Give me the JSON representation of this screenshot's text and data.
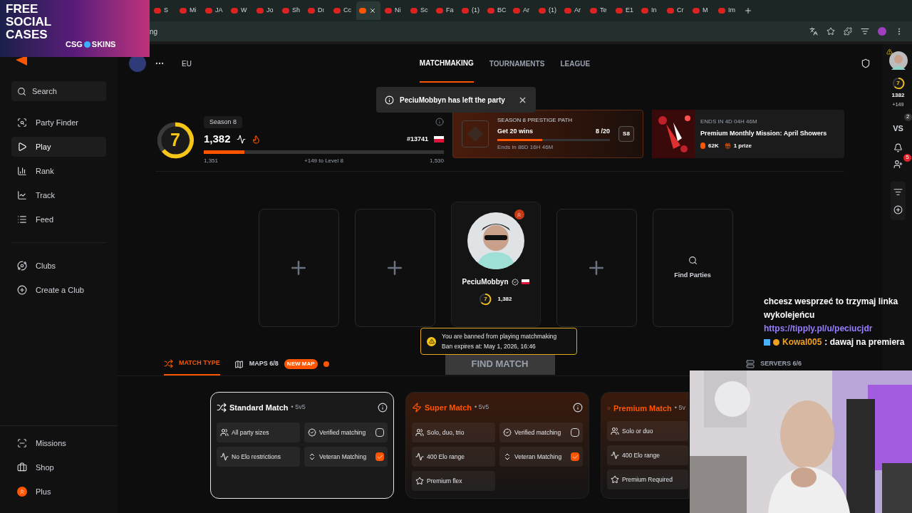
{
  "browser": {
    "tabs": [
      {
        "label": "S",
        "selected": false
      },
      {
        "label": "Mi",
        "selected": false
      },
      {
        "label": "JA",
        "selected": false
      },
      {
        "label": "W",
        "selected": false
      },
      {
        "label": "Jo",
        "selected": false
      },
      {
        "label": "Sh",
        "selected": false
      },
      {
        "label": "Dı",
        "selected": false
      },
      {
        "label": "Cc",
        "selected": false
      },
      {
        "selected": true
      },
      {
        "label": "Ni",
        "selected": false
      },
      {
        "label": "Sc",
        "selected": false
      },
      {
        "label": "Fa",
        "selected": false
      },
      {
        "label": "(1)",
        "selected": false
      },
      {
        "label": "BC",
        "selected": false
      },
      {
        "label": "Ar",
        "selected": false
      },
      {
        "label": "(1)",
        "selected": false
      },
      {
        "label": "Ar",
        "selected": false
      },
      {
        "label": "Te",
        "selected": false
      },
      {
        "label": "E1",
        "selected": false
      },
      {
        "label": "In",
        "selected": false
      },
      {
        "label": "Cr",
        "selected": false
      },
      {
        "label": "M",
        "selected": false
      },
      {
        "label": "Im",
        "selected": false
      }
    ],
    "address": "ng"
  },
  "promo_overlay": {
    "title": "FREE SOCIAL CASES",
    "brand_left": "CSG",
    "brand_right": "SKINS"
  },
  "sidebar": {
    "search_placeholder": "Search",
    "items": [
      {
        "label": "Party Finder",
        "selected": false
      },
      {
        "label": "Play",
        "selected": true
      },
      {
        "label": "Rank",
        "selected": false
      },
      {
        "label": "Track",
        "selected": false
      },
      {
        "label": "Feed",
        "selected": false
      }
    ],
    "club_items": [
      {
        "label": "Clubs"
      },
      {
        "label": "Create a Club"
      }
    ],
    "bottom_items": [
      {
        "label": "Missions"
      },
      {
        "label": "Shop"
      },
      {
        "label": "Plus"
      }
    ]
  },
  "header": {
    "region": "EU",
    "nav": [
      {
        "label": "MATCHMAKING",
        "selected": true
      },
      {
        "label": "TOURNAMENTS",
        "selected": false
      },
      {
        "label": "LEAGUE",
        "selected": false
      }
    ]
  },
  "toast": {
    "text": "PeciuMobbyn has left the party"
  },
  "season": {
    "level_badge": "7",
    "season": "Season 8",
    "elo": "1,382",
    "rank": "#13741",
    "level": 0.17,
    "min": "1,351",
    "to_next": "+149 to Level 8",
    "max": "1,530"
  },
  "prestige": {
    "label": "SEASON 8 PRESTIGE PATH",
    "title": "Get 20 wins",
    "count": "8 /20",
    "level": 0.4,
    "ends": "Ends in 86D 16H 46M",
    "badge": "S8"
  },
  "mission": {
    "ends": "ENDS IN 4D 04H 46M",
    "title": "Premium Monthly Mission: April Showers",
    "points": "62K",
    "prize": "1 prize"
  },
  "slots": [
    {
      "kind": "empty"
    },
    {
      "kind": "empty"
    },
    {
      "kind": "player",
      "name": "PeciuMobbyn",
      "level_badge": "7",
      "elo": "1,382"
    },
    {
      "kind": "empty"
    },
    {
      "kind": "find",
      "label": "Find Parties"
    }
  ],
  "ban": {
    "line1": "You are banned from playing matchmaking",
    "line2": "Ban expires at: May 1, 2026, 16:46"
  },
  "find_match": {
    "label": "FIND MATCH",
    "disabled": true
  },
  "match_tabs": [
    {
      "label": "MATCH TYPE",
      "selected": true
    },
    {
      "label": "MAPS 6/8",
      "selected": false,
      "badge": "NEW MAP"
    },
    {
      "label": "SERVERS 6/6",
      "selected": false
    }
  ],
  "match_cards": [
    {
      "title": "Standard Match",
      "mode": "• 5v5",
      "selected": true,
      "features": [
        {
          "kind": "plain",
          "label": "All party sizes"
        },
        {
          "kind": "toggle",
          "label": "Verified matching",
          "checked": false
        },
        {
          "kind": "plain",
          "label": "No Elo restrictions"
        },
        {
          "kind": "toggle",
          "label": "Veteran Matching",
          "checked": true
        }
      ]
    },
    {
      "title": "Super Match",
      "mode": "• 5v5",
      "selected": false,
      "features": [
        {
          "kind": "plain",
          "label": "Solo, duo, trio"
        },
        {
          "kind": "toggle",
          "label": "Verified matching",
          "checked": false
        },
        {
          "kind": "plain",
          "label": "400 Elo range"
        },
        {
          "kind": "toggle",
          "label": "Veteran Matching",
          "checked": true
        },
        {
          "kind": "plain",
          "label": "Premium flex"
        }
      ]
    },
    {
      "title": "Premium Match",
      "mode": "• 5v",
      "selected": false,
      "features": [
        {
          "kind": "plain",
          "label": "Solo or duo"
        },
        {
          "kind": "plain",
          "label": "400 Elo range"
        },
        {
          "kind": "plain",
          "label": "Premium Required"
        }
      ]
    }
  ],
  "right_rail": {
    "level_badge": "7",
    "elo": "1382",
    "gain": "+149",
    "vs_label": "VS",
    "vs_count": "2",
    "friends_count": "5"
  },
  "chat": {
    "message": "chcesz wesprzeć to trzymaj linka wykolejeńcu",
    "link": "https://tipply.pl/u/peciucjdr",
    "user": "Kowal005",
    "user_message": ": dawaj na premiera"
  }
}
